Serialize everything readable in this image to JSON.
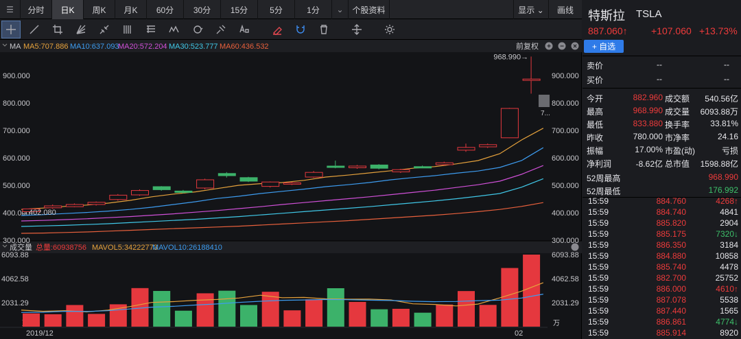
{
  "periods": [
    {
      "label": "分时",
      "w": 46
    },
    {
      "label": "日K",
      "w": 46,
      "active": true
    },
    {
      "label": "周K",
      "w": 46
    },
    {
      "label": "月K",
      "w": 46
    },
    {
      "label": "60分",
      "w": 54
    },
    {
      "label": "30分",
      "w": 54
    },
    {
      "label": "15分",
      "w": 54
    },
    {
      "label": "5分",
      "w": 54
    },
    {
      "label": "1分",
      "w": 54
    }
  ],
  "period_dropdown_icon": "chevron-down-icon",
  "stock_info_label": "个股资料",
  "display_label": "显示",
  "draw_label": "画线",
  "tools": [
    "crosshair-icon",
    "line-icon",
    "crop-icon",
    "fan-icon",
    "arrows-icon",
    "bars-icon",
    "ruler-icon",
    "wave-icon",
    "cycle-icon",
    "pitchfork-icon",
    "text-icon",
    "eraser-icon",
    "magnet-icon",
    "trash-icon",
    "move-icon",
    "gear-icon"
  ],
  "ma_legend": {
    "label": "MA",
    "items": [
      {
        "text": "MA5:707.886",
        "color": "#e6a23c"
      },
      {
        "text": "MA10:637.093",
        "color": "#3d9cf0"
      },
      {
        "text": "MA20:572.204",
        "color": "#d050d8"
      },
      {
        "text": "MA30:523.777",
        "color": "#40c8e8"
      },
      {
        "text": "MA60:436.532",
        "color": "#e8603c"
      }
    ],
    "adjust": "前复权"
  },
  "vol_legend": {
    "label": "成交量",
    "items": [
      {
        "text": "总量:60938756",
        "color": "#ee3b3b"
      },
      {
        "text": "MAVOL5:34222773",
        "color": "#e6a23c"
      },
      {
        "text": "MAVOL10:26188410",
        "color": "#3d9cf0"
      }
    ]
  },
  "chart_data": {
    "type": "candlestick",
    "price_axis": [
      "900.000",
      "800.000",
      "700.000",
      "600.000",
      "500.000",
      "400.000",
      "300.000"
    ],
    "price_range": [
      300,
      950
    ],
    "vol_axis": [
      "6093.88",
      "4062.58",
      "2031.29"
    ],
    "vol_unit": "万",
    "vol_max": 6093.88,
    "x_labels": [
      "2019/12",
      "02"
    ],
    "max_label": "968.990→",
    "min_label": "←402.080",
    "cut_label": "7...",
    "candles": [
      {
        "o": 404,
        "c": 414,
        "h": 416,
        "l": 402.08
      },
      {
        "o": 418,
        "c": 425,
        "h": 430,
        "l": 414
      },
      {
        "o": 422,
        "c": 430,
        "h": 434,
        "l": 420
      },
      {
        "o": 430,
        "c": 438,
        "h": 441,
        "l": 426
      },
      {
        "o": 448,
        "c": 464,
        "h": 468,
        "l": 444
      },
      {
        "o": 465,
        "c": 481,
        "h": 485,
        "l": 462
      },
      {
        "o": 495,
        "c": 484,
        "h": 497,
        "l": 480
      },
      {
        "o": 479,
        "c": 474,
        "h": 483,
        "l": 470
      },
      {
        "o": 490,
        "c": 520,
        "h": 524,
        "l": 485
      },
      {
        "o": 543,
        "c": 535,
        "h": 548,
        "l": 528
      },
      {
        "o": 528,
        "c": 515,
        "h": 531,
        "l": 512
      },
      {
        "o": 496,
        "c": 512,
        "h": 514,
        "l": 492
      },
      {
        "o": 504,
        "c": 509,
        "h": 512,
        "l": 501
      },
      {
        "o": 530,
        "c": 547,
        "h": 552,
        "l": 527
      },
      {
        "o": 570,
        "c": 568,
        "h": 590,
        "l": 562
      },
      {
        "o": 564,
        "c": 570,
        "h": 574,
        "l": 560
      },
      {
        "o": 574,
        "c": 562,
        "h": 577,
        "l": 558
      },
      {
        "o": 549,
        "c": 557,
        "h": 560,
        "l": 545
      },
      {
        "o": 568,
        "c": 566,
        "h": 572,
        "l": 563
      },
      {
        "o": 575,
        "c": 582,
        "h": 586,
        "l": 572
      },
      {
        "o": 628,
        "c": 638,
        "h": 652,
        "l": 622
      },
      {
        "o": 640,
        "c": 648,
        "h": 652,
        "l": 636
      },
      {
        "o": 673,
        "c": 780,
        "h": 782,
        "l": 672
      },
      {
        "o": 882.96,
        "c": 887.06,
        "h": 968.99,
        "l": 833.88
      }
    ],
    "volume": [
      {
        "v": 1120,
        "up": true
      },
      {
        "v": 1050,
        "up": true
      },
      {
        "v": 1830,
        "up": true
      },
      {
        "v": 1080,
        "up": true
      },
      {
        "v": 1890,
        "up": true
      },
      {
        "v": 3260,
        "up": true
      },
      {
        "v": 3020,
        "up": false
      },
      {
        "v": 1350,
        "up": false
      },
      {
        "v": 2820,
        "up": true
      },
      {
        "v": 3040,
        "up": false
      },
      {
        "v": 1830,
        "up": false
      },
      {
        "v": 2950,
        "up": true
      },
      {
        "v": 1380,
        "up": true
      },
      {
        "v": 2310,
        "up": true
      },
      {
        "v": 3250,
        "up": false
      },
      {
        "v": 2090,
        "up": true
      },
      {
        "v": 1470,
        "up": false
      },
      {
        "v": 1510,
        "up": true
      },
      {
        "v": 1180,
        "up": false
      },
      {
        "v": 1870,
        "up": true
      },
      {
        "v": 3010,
        "up": true
      },
      {
        "v": 1840,
        "up": true
      },
      {
        "v": 4960,
        "up": true
      },
      {
        "v": 6093.88,
        "up": true
      }
    ],
    "ma5": [
      412,
      417,
      423,
      428,
      435,
      445,
      458,
      468,
      476,
      488,
      500,
      506,
      510,
      518,
      530,
      537,
      545,
      553,
      562,
      568,
      578,
      590,
      615,
      665,
      708
    ],
    "ma10": [
      390,
      393,
      397,
      401,
      406,
      412,
      420,
      430,
      440,
      452,
      460,
      470,
      478,
      486,
      495,
      502,
      510,
      520,
      528,
      535,
      544,
      552,
      565,
      590,
      637
    ],
    "ma20": [
      370,
      372,
      375,
      378,
      382,
      386,
      391,
      396,
      402,
      408,
      415,
      422,
      430,
      437,
      444,
      451,
      458,
      466,
      474,
      482,
      492,
      502,
      515,
      540,
      572
    ],
    "ma30": [
      350,
      352,
      354,
      357,
      360,
      364,
      368,
      372,
      376,
      381,
      386,
      392,
      398,
      404,
      410,
      416,
      422,
      429,
      436,
      443,
      451,
      460,
      470,
      493,
      524
    ],
    "ma60": [
      325,
      326,
      328,
      330,
      333,
      336,
      339,
      342,
      345,
      348,
      351,
      355,
      359,
      363,
      367,
      371,
      376,
      381,
      386,
      391,
      397,
      404,
      412,
      423,
      437
    ],
    "mavol5": [
      1400,
      1300,
      1350,
      1250,
      1400,
      1700,
      2050,
      2120,
      2230,
      2300,
      2420,
      2660,
      2450,
      2470,
      2350,
      2320,
      2330,
      2260,
      1930,
      1880,
      1750,
      1910,
      2430,
      3000,
      3720
    ],
    "mavol10": [
      1200,
      1220,
      1300,
      1280,
      1350,
      1500,
      1650,
      1720,
      1830,
      1920,
      2050,
      2150,
      2230,
      2260,
      2300,
      2280,
      2240,
      2210,
      2150,
      2110,
      2130,
      2200,
      2240,
      2420,
      2750
    ]
  },
  "quote": {
    "name": "特斯拉",
    "code": "TSLA",
    "price": "887.060↑",
    "change": "+107.060",
    "pct": "+13.73%",
    "add_label": "+ 自选",
    "sell_label": "卖价",
    "sell_val": "--",
    "sell_vol": "--",
    "buy_label": "买价",
    "buy_val": "--",
    "buy_vol": "--",
    "stats": [
      {
        "l1": "今开",
        "v1": "882.960",
        "c1": "red",
        "l2": "成交额",
        "v2": "540.56亿",
        "c2": "white"
      },
      {
        "l1": "最高",
        "v1": "968.990",
        "c1": "red",
        "l2": "成交量",
        "v2": "6093.88万",
        "c2": "white"
      },
      {
        "l1": "最低",
        "v1": "833.880",
        "c1": "red",
        "l2": "换手率",
        "v2": "33.81%",
        "c2": "white"
      },
      {
        "l1": "昨收",
        "v1": "780.000",
        "c1": "white",
        "l2": "市净率",
        "v2": "24.16",
        "c2": "white"
      },
      {
        "l1": "振幅",
        "v1": "17.00%",
        "c1": "white",
        "l2": "市盈(动)",
        "v2": "亏损",
        "c2": "white"
      },
      {
        "l1": "净利润",
        "v1": "-8.62亿",
        "c1": "white",
        "l2": "总市值",
        "v2": "1598.88亿",
        "c2": "white"
      }
    ],
    "w52h_label": "52周最高",
    "w52h_val": "968.990",
    "w52l_label": "52周最低",
    "w52l_val": "176.992"
  },
  "ticks": [
    {
      "t": "15:59",
      "p": "884.760",
      "v": "4268↑",
      "c": "red",
      "vc": "red"
    },
    {
      "t": "15:59",
      "p": "884.740",
      "v": "4841",
      "c": "red",
      "vc": "white"
    },
    {
      "t": "15:59",
      "p": "885.820",
      "v": "2904",
      "c": "red",
      "vc": "white"
    },
    {
      "t": "15:59",
      "p": "885.175",
      "v": "7320↓",
      "c": "red",
      "vc": "green"
    },
    {
      "t": "15:59",
      "p": "886.350",
      "v": "3184",
      "c": "red",
      "vc": "white"
    },
    {
      "t": "15:59",
      "p": "884.880",
      "v": "10858",
      "c": "red",
      "vc": "white"
    },
    {
      "t": "15:59",
      "p": "885.740",
      "v": "4478",
      "c": "red",
      "vc": "white"
    },
    {
      "t": "15:59",
      "p": "882.700",
      "v": "25752",
      "c": "red",
      "vc": "white"
    },
    {
      "t": "15:59",
      "p": "886.000",
      "v": "4610↑",
      "c": "red",
      "vc": "red"
    },
    {
      "t": "15:59",
      "p": "887.078",
      "v": "5538",
      "c": "red",
      "vc": "white"
    },
    {
      "t": "15:59",
      "p": "887.440",
      "v": "1565",
      "c": "red",
      "vc": "white"
    },
    {
      "t": "15:59",
      "p": "886.861",
      "v": "4774↓",
      "c": "red",
      "vc": "green"
    },
    {
      "t": "15:59",
      "p": "885.914",
      "v": "8920",
      "c": "red",
      "vc": "white"
    }
  ]
}
